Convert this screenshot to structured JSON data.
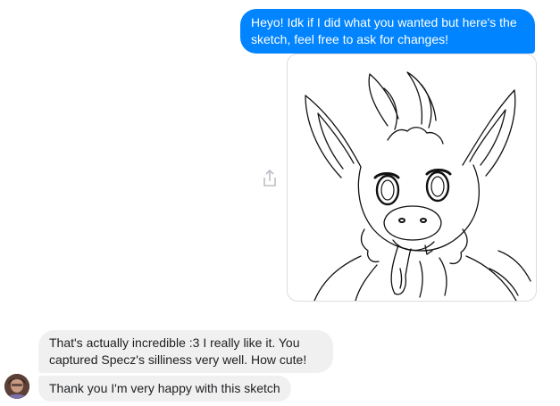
{
  "messages": {
    "outgoing_1": "Heyo! Idk if I did what you wanted but here's the sketch, feel free to ask for changes!",
    "incoming_1": "That's actually incredible :3 I really like it. You captured Specz's silliness very well. How cute!",
    "incoming_2": "Thank you I'm very happy with this sketch"
  },
  "attachment": {
    "type": "image",
    "subject": "line-art sketch of a horned creature with big ears sticking its tongue out"
  },
  "icons": {
    "share": "share-icon",
    "avatar": "avatar"
  },
  "colors": {
    "outgoing_bubble": "#0084ff",
    "incoming_bubble": "#f1f0f0",
    "border": "#dadde1"
  }
}
